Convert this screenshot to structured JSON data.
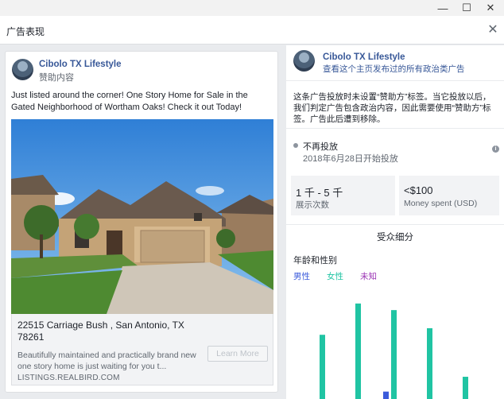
{
  "window": {
    "controls": [
      "—",
      "☐",
      "✕"
    ]
  },
  "header": {
    "title": "广告表现",
    "close_glyph": "✕"
  },
  "ad": {
    "page_name": "Cibolo TX Lifestyle",
    "sponsored": "赞助内容",
    "text": "Just listed around the corner! One Story Home for Sale in the Gated Neighborhood of Wortham Oaks! Check it out Today!",
    "link_title": "22515 Carriage Bush , San Antonio, TX 78261",
    "link_description": "Beautifully maintained and practically brand new one story home is just waiting for you t...",
    "link_domain": "LISTINGS.REALBIRD.COM",
    "cta_label": "Learn More"
  },
  "panel": {
    "page_name": "Cibolo TX Lifestyle",
    "view_all_link": "查看这个主页发布过的所有政治类广告",
    "notice": "这条广告投放时未设置“赞助方”标签。当它投放以后，我们判定广告包含政治内容，因此需要使用“赞助方”标签。广告此后遭到移除。",
    "status": "不再投放",
    "start_date": "2018年6月28日开始投放",
    "info_glyph": "i",
    "impressions_value": "1 千 - 5 千",
    "impressions_label": "展示次数",
    "spend_value": "<$100",
    "spend_label": "Money spent (USD)",
    "audience_title": "受众细分",
    "age_gender_title": "年龄和性别"
  },
  "colors": {
    "male": "#3b5bdb",
    "female": "#20c4a3",
    "unknown": "#9c36b5",
    "link": "#385898"
  },
  "chart_data": {
    "type": "bar",
    "title": "年龄和性别",
    "legend": [
      "男性",
      "女性",
      "未知"
    ],
    "legend_placement": "top-left",
    "series": [
      {
        "name": "男性",
        "values": [
          0,
          0,
          9,
          0,
          0,
          0
        ]
      },
      {
        "name": "女性",
        "values": [
          78,
          116,
          108,
          86,
          27,
          0
        ]
      },
      {
        "name": "未知",
        "values": [
          0,
          0,
          0,
          0,
          0,
          0
        ]
      }
    ],
    "ylim": [
      0,
      140
    ],
    "grid": false
  }
}
